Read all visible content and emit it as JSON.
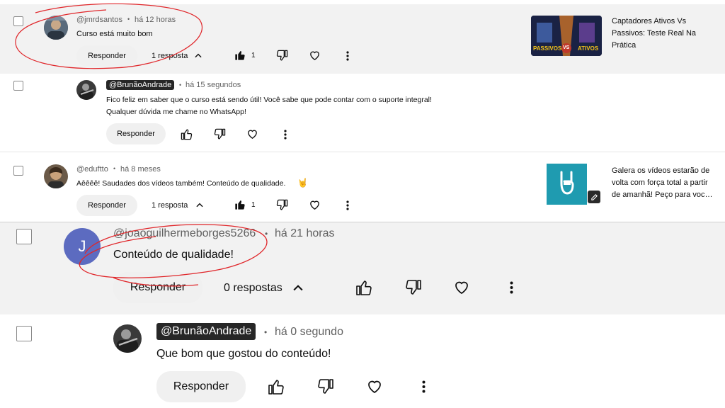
{
  "comments": [
    {
      "handle": "@jmrdsantos",
      "time": "há 12 horas",
      "text": "Curso está muito bom",
      "reply_label": "Responder",
      "replies_label": "1 resposta",
      "like_count": "1",
      "video_title": "Captadores Ativos Vs Passivos: Teste Real Na Prática",
      "thumb_text_left": "PASSIVOS",
      "thumb_text_right": "ATIVOS",
      "thumb_vs": "VS"
    },
    {
      "handle": "@BrunãoAndrade",
      "time": "há 15 segundos",
      "text_line1": "Fico feliz em saber que o curso está sendo útil! Você sabe que pode contar com o suporte integral!",
      "text_line2": "Qualquer dúvida me chame no WhatsApp!",
      "reply_label": "Responder"
    },
    {
      "handle": "@eduftto",
      "time": "há 8 meses",
      "text": "Aêêêê! Saudades dos vídeos também! Conteúdo de qualidade.",
      "emoji": "🤘",
      "reply_label": "Responder",
      "replies_label": "1 resposta",
      "like_count": "1",
      "video_title": "Galera os vídeos estarão de volta com força total a partir de amanhã! Peço para voc…"
    },
    {
      "handle": "@joaoguilhermeborges5266",
      "time": "há 21 horas",
      "text": "Conteúdo de qualidade!",
      "avatar_letter": "J",
      "reply_label": "Responder",
      "replies_label": "0 respostas"
    },
    {
      "handle": "@BrunãoAndrade",
      "time": "há 0 segundo",
      "text": "Que bom que gostou do conteúdo!",
      "reply_label": "Responder"
    }
  ],
  "separator": "•",
  "colors": {
    "annotation_red": "#e0262a",
    "highlight_bg": "#f2f2f2",
    "chip_bg": "#272727",
    "avatar_j": "#5c6bc0",
    "thumb_teal": "#1f9bb0"
  }
}
